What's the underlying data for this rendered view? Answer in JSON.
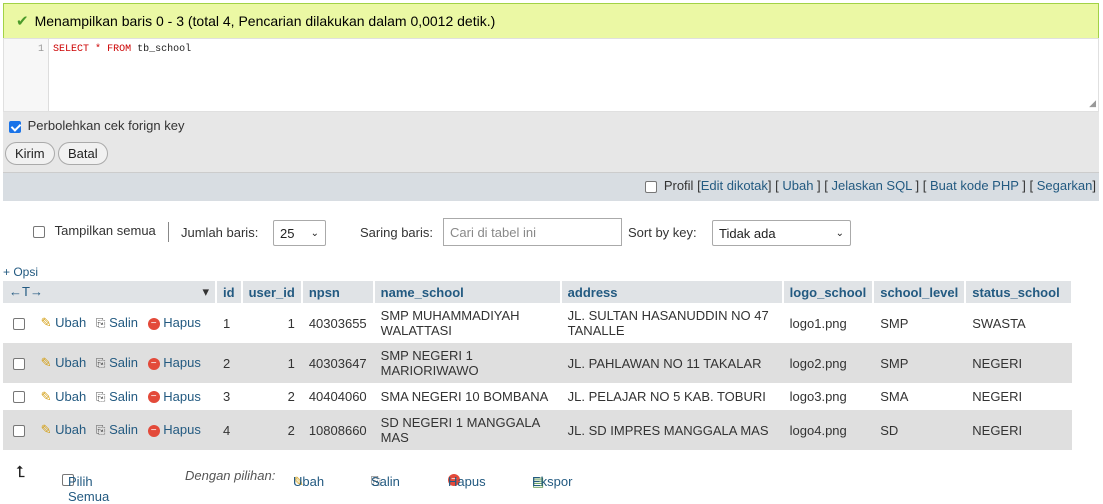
{
  "status": {
    "message": "Menampilkan baris 0 - 3 (total 4, Pencarian dilakukan dalam 0,0012 detik.)"
  },
  "sql": {
    "line_number": "1",
    "kw_select": "SELECT",
    "star": "*",
    "kw_from": "FROM",
    "table": "tb_school"
  },
  "options": {
    "foreign_key_check": "Perbolehkan cek forign key"
  },
  "buttons": {
    "submit": "Kirim",
    "cancel": "Batal"
  },
  "profile": {
    "label": "Profil",
    "links": [
      "Edit dikotak",
      "Ubah",
      "Jelaskan SQL",
      "Buat kode PHP",
      "Segarkan"
    ]
  },
  "nav": {
    "show_all": "Tampilkan semua",
    "rows_label": "Jumlah baris:",
    "rows_value": "25",
    "filter_label": "Saring baris:",
    "filter_placeholder": "Cari di tabel ini",
    "sort_label": "Sort by key:",
    "sort_value": "Tidak ada"
  },
  "options_link": "+ Opsi",
  "arrows": "←T→",
  "table": {
    "columns": [
      "id",
      "user_id",
      "npsn",
      "name_school",
      "address",
      "logo_school",
      "school_level",
      "status_school"
    ],
    "action_labels": {
      "edit": "Ubah",
      "copy": "Salin",
      "delete": "Hapus"
    },
    "rows": [
      {
        "id": "1",
        "user_id": "1",
        "npsn": "40303655",
        "name_school": "SMP MUHAMMADIYAH WALATTASI",
        "address": "JL. SULTAN HASANUDDIN NO 47 TANALLE",
        "logo_school": "logo1.png",
        "school_level": "SMP",
        "status_school": "SWASTA"
      },
      {
        "id": "2",
        "user_id": "1",
        "npsn": "40303647",
        "name_school": "SMP NEGERI 1 MARIORIWAWO",
        "address": "JL. PAHLAWAN NO 11 TAKALAR",
        "logo_school": "logo2.png",
        "school_level": "SMP",
        "status_school": "NEGERI"
      },
      {
        "id": "3",
        "user_id": "2",
        "npsn": "40404060",
        "name_school": "SMA NEGERI 10 BOMBANA",
        "address": "JL. PELAJAR NO 5 KAB. TOBURI",
        "logo_school": "logo3.png",
        "school_level": "SMA",
        "status_school": "NEGERI"
      },
      {
        "id": "4",
        "user_id": "2",
        "npsn": "10808660",
        "name_school": "SD NEGERI 1 MANGGALA MAS",
        "address": "JL. SD IMPRES MANGGALA MAS",
        "logo_school": "logo4.png",
        "school_level": "SD",
        "status_school": "NEGERI"
      }
    ]
  },
  "footer": {
    "select_all": "Pilih Semua",
    "with_selected": "Dengan pilihan:",
    "edit": "Ubah",
    "copy": "Salin",
    "delete": "Hapus",
    "export": "Ekspor"
  }
}
